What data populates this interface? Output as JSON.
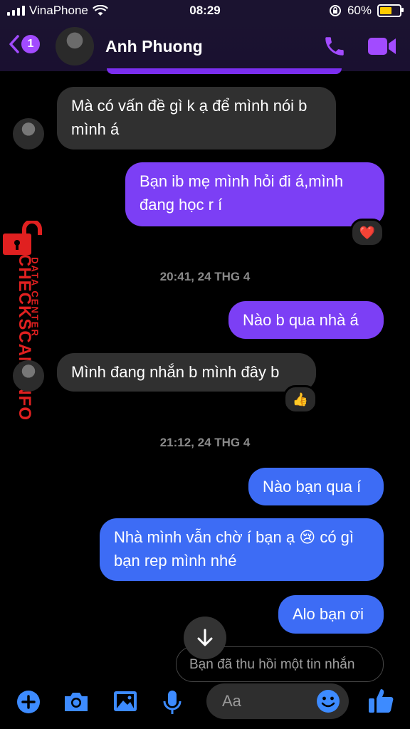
{
  "status_bar": {
    "carrier": "VinaPhone",
    "time": "08:29",
    "battery": "60%",
    "battery_level": 0.6
  },
  "header": {
    "back_count": "1",
    "contact_name": "Anh Phuong"
  },
  "messages": [
    {
      "text": "Mà có vấn đề gì k ạ để mình nói b mình á"
    },
    {
      "text": "Bạn ib mẹ mình hỏi đi á,mình đang học r í",
      "reaction": "❤️"
    },
    {
      "text": "Nào b qua nhà á"
    },
    {
      "text": "Mình đang nhắn b mình đây b",
      "reaction": "👍"
    },
    {
      "text": "Nào bạn qua í"
    },
    {
      "text_before_emoji": "Nhà mình vẫn chờ í bạn ạ",
      "emoji": "😢",
      "text_after_emoji": "có gì bạn rep mình nhé"
    },
    {
      "text": "Alo bạn ơi"
    }
  ],
  "timestamps": [
    "20:41, 24 THG 4",
    "21:12, 24 THG 4"
  ],
  "unsent_notice": "Bạn đã thu hồi một tin nhắn",
  "watermark": {
    "brand": "CHECKSCAM.INFO",
    "sub": "DATA CENTER"
  },
  "composer": {
    "placeholder": "Aa"
  },
  "colors": {
    "accent": "#a24bff",
    "incoming": "#303030",
    "outgoing_purple": "#7c3ff5",
    "outgoing_blue": "#3d6cf5",
    "watermark": "#e02020"
  },
  "icons": [
    "back-chevron-icon",
    "phone-icon",
    "video-camera-icon",
    "arrow-down-icon",
    "add-icon",
    "camera-icon",
    "gallery-icon",
    "microphone-icon",
    "emoji-icon",
    "thumbs-up-icon",
    "lock-icon"
  ]
}
